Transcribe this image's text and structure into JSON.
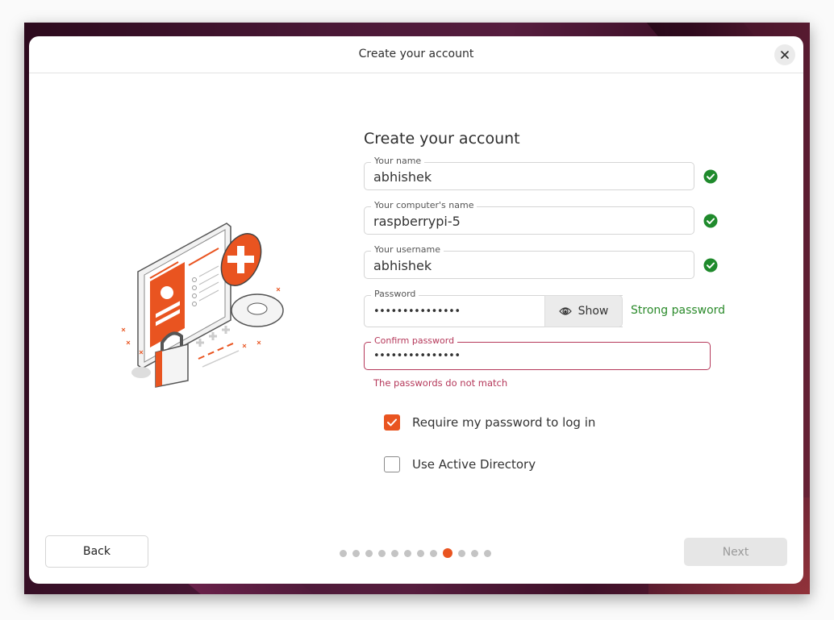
{
  "window": {
    "title": "Create your account",
    "close_icon": "close-icon"
  },
  "form": {
    "heading": "Create your account",
    "fields": [
      {
        "label": "Your name",
        "value": "abhishek",
        "valid": true
      },
      {
        "label": "Your computer's name",
        "value": "raspberrypi-5",
        "valid": true
      },
      {
        "label": "Your username",
        "value": "abhishek",
        "valid": true
      }
    ],
    "password": {
      "label": "Password",
      "masked_value": "•••••••••••••••",
      "show_label": "Show",
      "show_icon": "eye-icon",
      "strength": "Strong password"
    },
    "confirm_password": {
      "label": "Confirm password",
      "masked_value": "•••••••••••••••",
      "error": "The passwords do not match"
    },
    "options": [
      {
        "label": "Require my password to log in",
        "checked": true
      },
      {
        "label": "Use Active Directory",
        "checked": false
      }
    ]
  },
  "footer": {
    "back_label": "Back",
    "next_label": "Next",
    "next_enabled": false,
    "pager": {
      "total": 12,
      "current": 9
    }
  },
  "colors": {
    "accent": "#e95420",
    "success": "#2a8a2a",
    "error": "#b5385a"
  }
}
